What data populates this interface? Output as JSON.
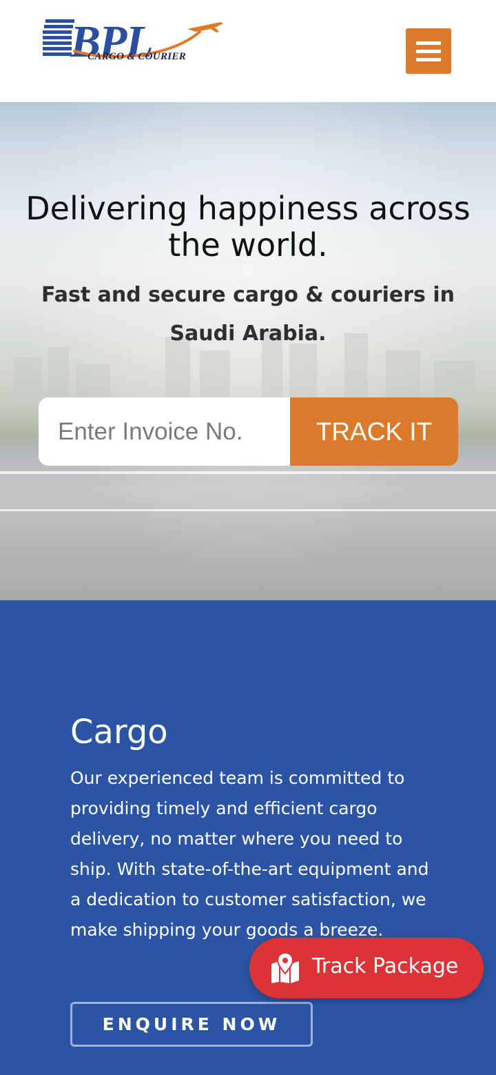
{
  "header": {
    "logo_text": "BPL",
    "logo_subtitle": "CARGO & COURIER",
    "menu_icon": "hamburger-menu-icon"
  },
  "hero": {
    "title": "Delivering happiness across the world.",
    "subtitle": "Fast and secure cargo & couriers in Saudi Arabia.",
    "search": {
      "placeholder": "Enter Invoice No.",
      "value": ""
    },
    "track_button_label": "TRACK IT"
  },
  "cargo": {
    "title": "Cargo",
    "description": "Our experienced team is committed to providing timely and efficient cargo delivery, no matter where you need to ship. With state-of-the-art equipment and a dedication to customer satisfaction, we make shipping your goods a breeze.",
    "enquire_label": "ENQUIRE NOW"
  },
  "floating_button": {
    "label": "Track Package",
    "icon": "map-marker-icon"
  },
  "colors": {
    "accent_orange": "#dd7a2c",
    "brand_blue": "#2b55a4",
    "float_red": "#dc3337"
  }
}
